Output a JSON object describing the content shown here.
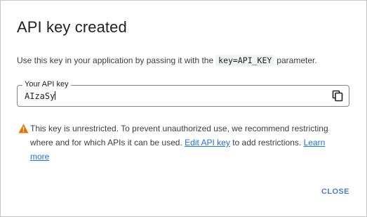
{
  "dialog": {
    "title": "API key created",
    "description_before": "Use this key in your application by passing it with the",
    "description_code": "key=API_KEY",
    "description_after": "parameter.",
    "field_label": "Your API key",
    "api_key_value": "AIzaSy",
    "copy_icon": "copy-icon",
    "warning_icon": "warning-icon",
    "warning_text_before": "This key is unrestricted. To prevent unauthorized use, we recommend restricting where and for which APIs it can be used.",
    "edit_link": "Edit API key",
    "warning_text_middle": "to add restrictions.",
    "learn_more_link": "Learn more",
    "close_label": "CLOSE"
  },
  "colors": {
    "accent": "#1a73e8",
    "close_text": "#4a7fc6",
    "warning": "#e37400",
    "text": "#3c4043",
    "title": "#202124"
  }
}
